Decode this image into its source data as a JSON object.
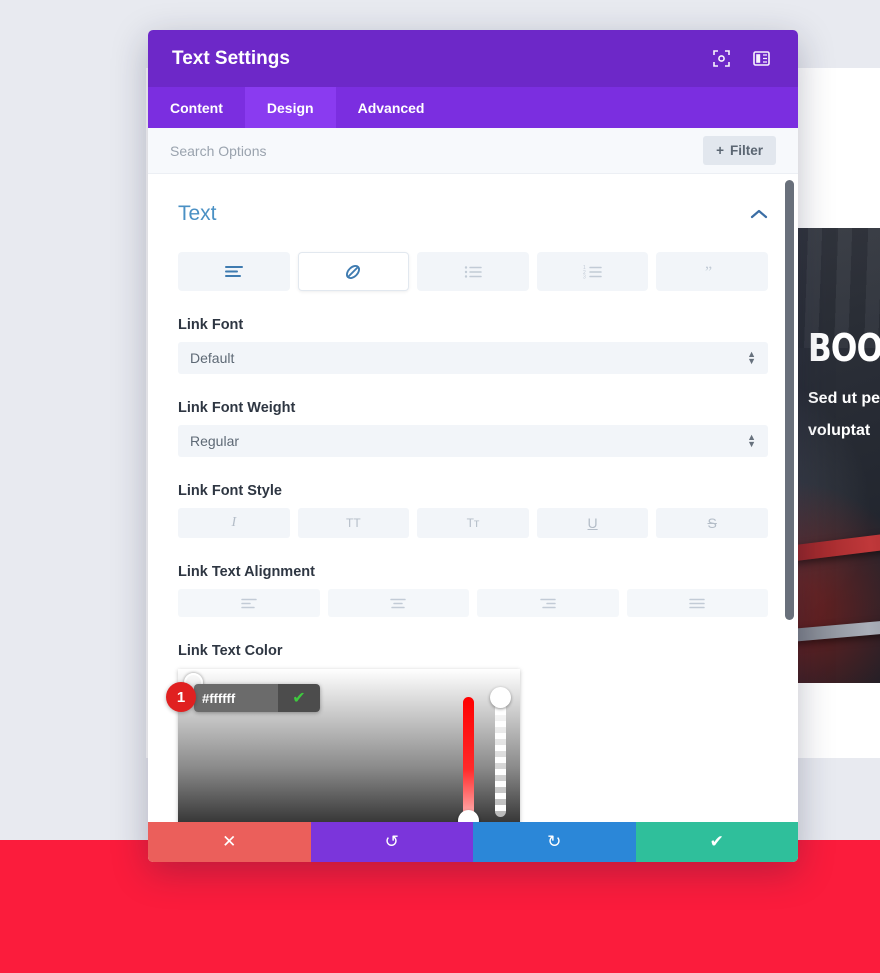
{
  "background": {
    "hero_title": "BOOK",
    "hero_sub_line1": "Sed ut pe",
    "hero_sub_line2": "voluptat"
  },
  "modal": {
    "title": "Text Settings",
    "header_icons": [
      {
        "name": "fullscreen-icon",
        "label": "Fullscreen"
      },
      {
        "name": "split-view-icon",
        "label": "Split view"
      }
    ],
    "tabs": [
      {
        "label": "Content",
        "active": false
      },
      {
        "label": "Design",
        "active": true
      },
      {
        "label": "Advanced",
        "active": false
      }
    ],
    "search": {
      "placeholder": "Search Options",
      "value": "",
      "filter_label": "Filter",
      "filter_plus": "+"
    },
    "section": {
      "title": "Text",
      "collapse_icon": "chevron-up-icon",
      "type_tabs": [
        {
          "icon": "paragraph-text-icon",
          "active": false
        },
        {
          "icon": "link-icon",
          "active": true
        },
        {
          "icon": "unordered-list-icon",
          "active": false
        },
        {
          "icon": "ordered-list-icon",
          "active": false
        },
        {
          "icon": "blockquote-icon",
          "active": false
        }
      ],
      "fields": {
        "link_font": {
          "label": "Link Font",
          "value": "Default"
        },
        "link_font_weight": {
          "label": "Link Font Weight",
          "value": "Regular"
        },
        "link_font_style": {
          "label": "Link Font Style",
          "buttons": [
            {
              "name": "italic",
              "glyph": "I"
            },
            {
              "name": "uppercase",
              "glyph": "TT"
            },
            {
              "name": "small-caps",
              "glyph": "Tт"
            },
            {
              "name": "underline",
              "glyph": "U"
            },
            {
              "name": "strikethrough",
              "glyph": "S"
            }
          ]
        },
        "link_text_alignment": {
          "label": "Link Text Alignment",
          "buttons": [
            {
              "name": "align-left-icon"
            },
            {
              "name": "align-center-icon"
            },
            {
              "name": "align-right-icon"
            },
            {
              "name": "align-justify-icon"
            }
          ]
        },
        "link_text_color": {
          "label": "Link Text Color",
          "hex_value": "#ffffff",
          "confirm_glyph": "✔",
          "step_badge": "1",
          "swatches": [
            "#000000",
            "#ffffff",
            "#f01b1b",
            "#e09010",
            "#e8d815",
            "#6ec458",
            "#2a8fd8",
            "#8a21d6"
          ]
        }
      }
    },
    "footer": {
      "cancel_glyph": "✕",
      "undo_glyph": "↺",
      "redo_glyph": "↻",
      "save_glyph": "✔",
      "colors": {
        "cancel": "#eb5f5b",
        "undo": "#7b35db",
        "redo": "#2b87d8",
        "save": "#2fbf9b"
      }
    }
  }
}
